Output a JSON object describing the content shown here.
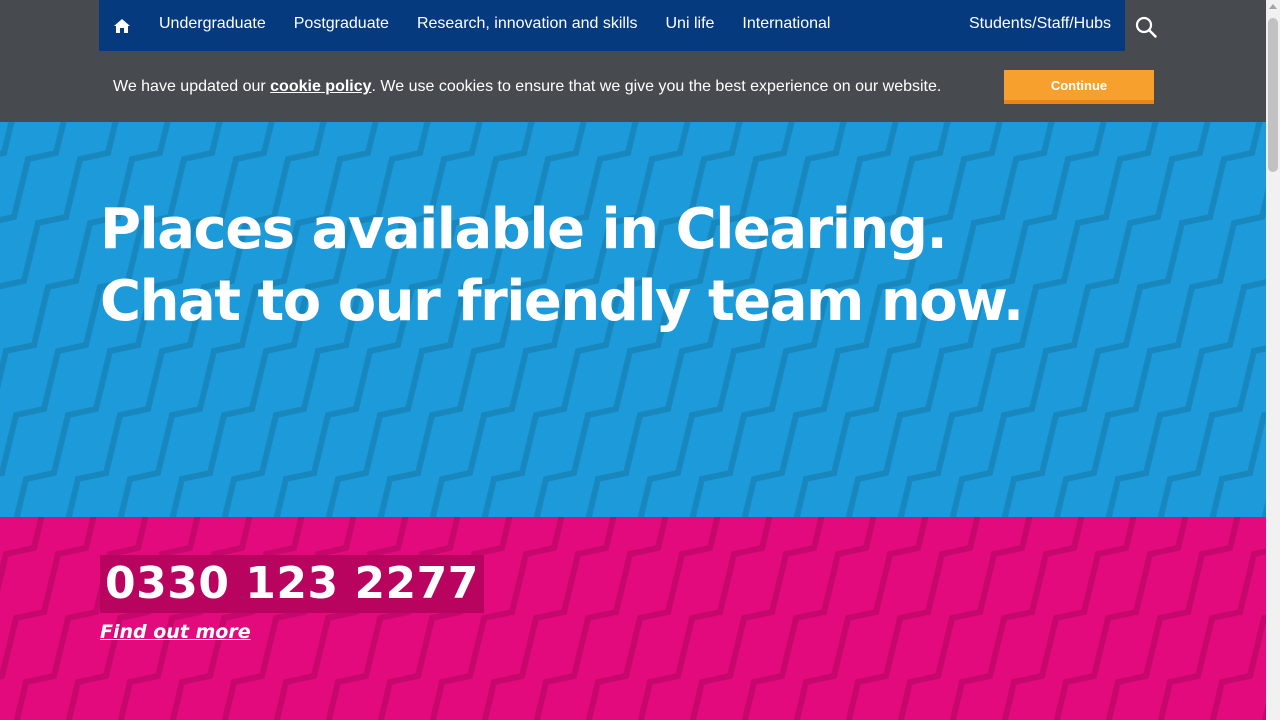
{
  "nav": {
    "home_icon": "home-icon",
    "items": [
      "Undergraduate",
      "Postgraduate",
      "Research, innovation and skills",
      "Uni life",
      "International"
    ],
    "hubs": "Students/Staff/Hubs",
    "search_icon": "search-icon"
  },
  "cookie": {
    "text_before": "We have updated our ",
    "link": "cookie policy",
    "text_after": ". We use cookies to ensure that we give you the best experience on our website.",
    "button": "Continue"
  },
  "hero": {
    "line1": "Places available in Clearing.",
    "line2": "Chat to our friendly team now."
  },
  "cta": {
    "phone": "0330 123 2277",
    "link": "Find out more"
  },
  "colors": {
    "nav_bg": "#063a7e",
    "top_band": "#474b4f",
    "accent_orange": "#f7a02e",
    "hero_blue": "#1c9ad9",
    "hero_pink": "#e20a7c",
    "phone_bg": "#b8045f"
  }
}
